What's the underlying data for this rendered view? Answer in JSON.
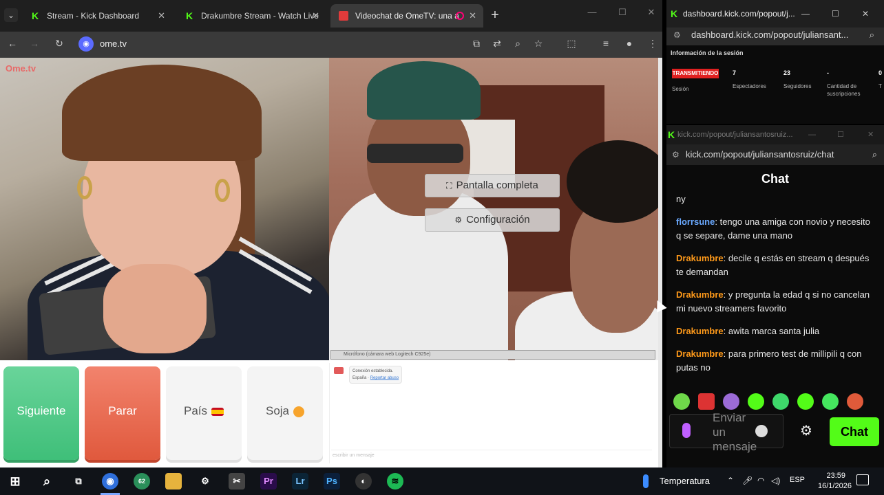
{
  "browser": {
    "tabs": [
      {
        "title": "Stream - Kick Dashboard",
        "favicon": "kick-icon"
      },
      {
        "title": "Drakumbre Stream - Watch Live",
        "favicon": "kick-icon"
      },
      {
        "title": "Videochat de OmeTV: una a",
        "favicon": "ometv-icon",
        "active": true
      }
    ],
    "url": "ome.tv"
  },
  "ometv": {
    "logo": "Ome.tv",
    "overlay_buttons": {
      "fullscreen": "Pantalla completa",
      "settings": "Configuración"
    },
    "mic_bar": "Micrófono (cámara web Logitech C925e)",
    "buttons": {
      "next": "Siguiente",
      "stop": "Parar",
      "country": "País",
      "sex": "Soja"
    },
    "system_message": {
      "line1": "Conexión establecida.",
      "line2": "España",
      "report": "Reportar abuso"
    },
    "input_placeholder": "escribir un mensaje"
  },
  "kick_dashboard": {
    "window_title": "dashboard.kick.com/popout/j...",
    "url": "dashboard.kick.com/popout/juliansant...",
    "section_title": "Información de la sesión",
    "live_badge": "TRANSMITIENDO",
    "session_label": "Sesión",
    "stats": [
      {
        "value": "7",
        "label": "Espectadores"
      },
      {
        "value": "23",
        "label": "Seguidores"
      },
      {
        "value": "-",
        "label": "Cantidad de suscripciones"
      },
      {
        "value": "0",
        "label": "T"
      }
    ]
  },
  "kick_chat": {
    "window_title": "kick.com/popout/juliansantosruiz...",
    "url": "kick.com/popout/juliansantosruiz/chat",
    "header": "Chat",
    "messages": [
      {
        "user": "",
        "text": "ny",
        "color": "#e8e8e8"
      },
      {
        "user": "florrsune",
        "text": "tengo una amiga con novio y necesito q se separe, dame una mano",
        "color": "#6aa9ff"
      },
      {
        "user": "Drakumbre",
        "text": "decile q estás en stream q después te demandan",
        "color": "#ff9a1a"
      },
      {
        "user": "Drakumbre",
        "text": "y pregunta la edad q si no cancelan mi nuevo streamers favorito",
        "color": "#ff9a1a"
      },
      {
        "user": "Drakumbre",
        "text": "awita marca santa julia",
        "color": "#ff9a1a"
      },
      {
        "user": "Drakumbre",
        "text": "para primero test de millipili q con putas no",
        "color": "#ff9a1a"
      }
    ],
    "input_placeholder": "Enviar un mensaje",
    "send_label": "Chat",
    "accent": "#53fc18"
  },
  "taskbar": {
    "weather": "Temperatura",
    "lang": "ESP",
    "time": "23:59",
    "date": "16/1/2026",
    "chrome_badge": "62"
  }
}
